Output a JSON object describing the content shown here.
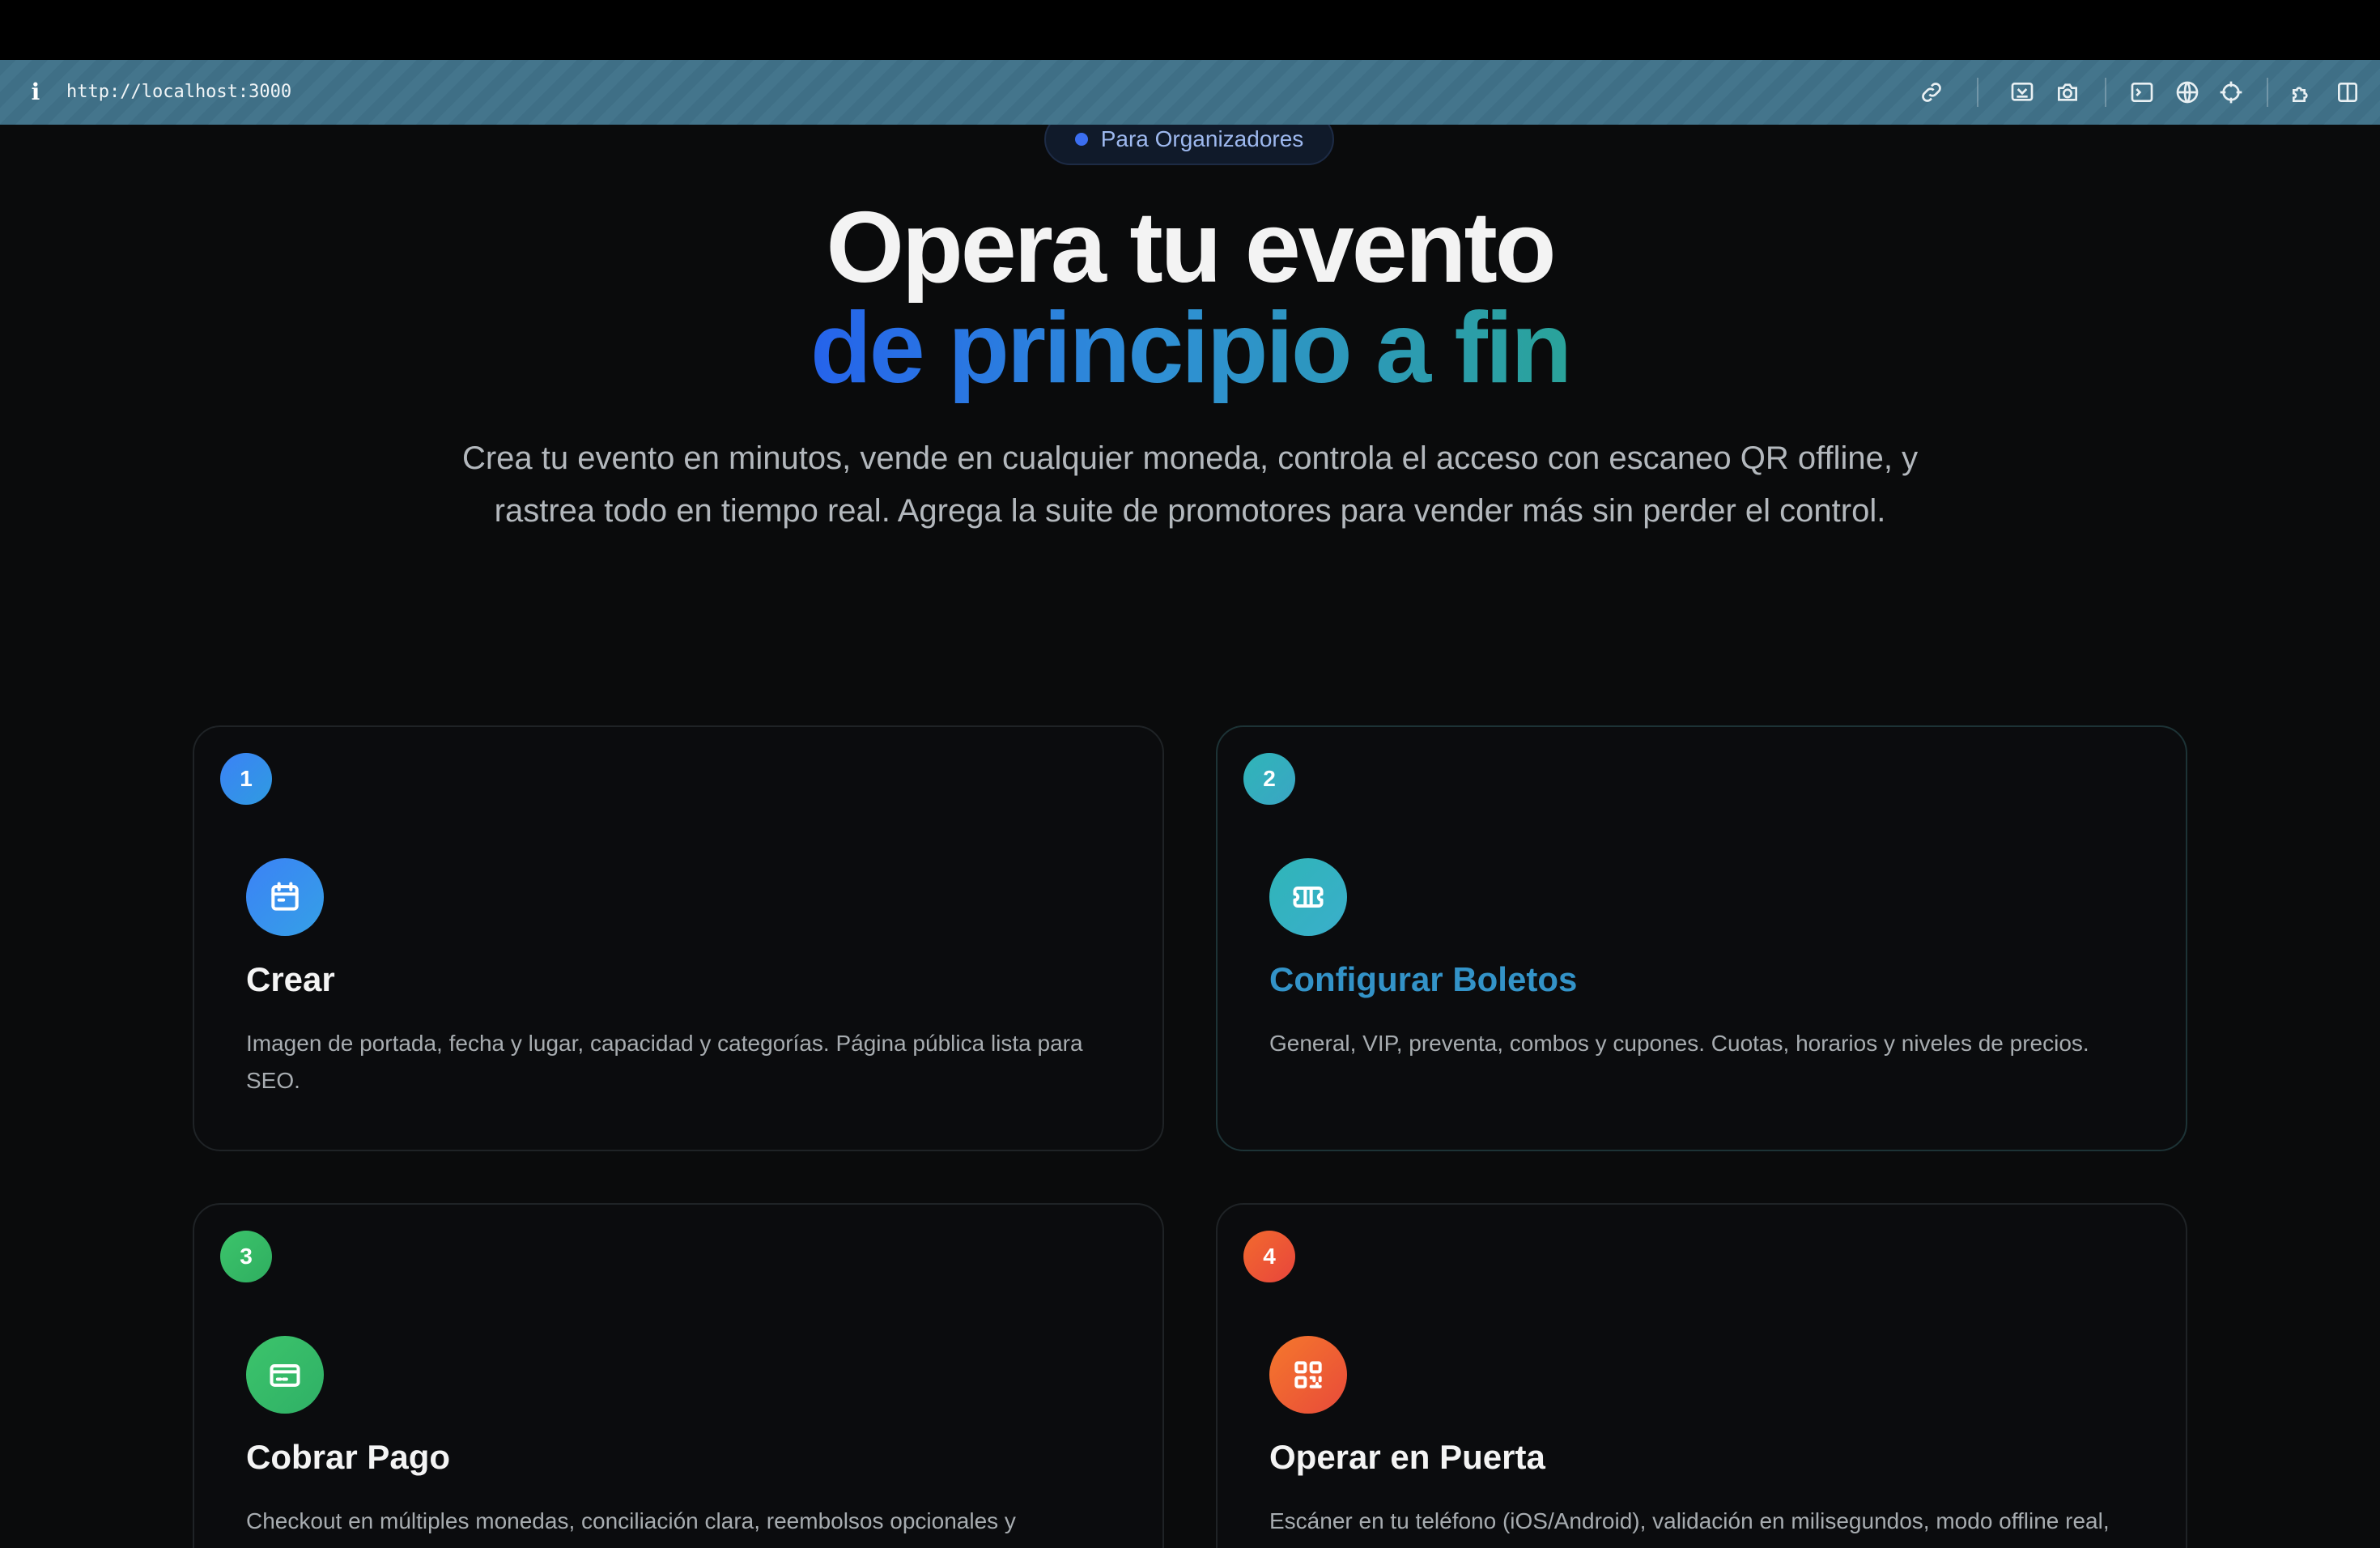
{
  "browser": {
    "url": "http://localhost:3000",
    "info_icon": "i",
    "toolbar_icons": [
      "link-icon",
      "inspect-icon",
      "camera-icon",
      "terminal-icon",
      "globe-icon",
      "crosshair-icon",
      "extensions-icon",
      "sidebar-icon"
    ]
  },
  "hero": {
    "pill_label": "Para Organizadores",
    "title_line1": "Opera tu evento",
    "title_line2": "de principio a fin",
    "subtitle": "Crea tu evento en minutos, vende en cualquier moneda, controla el acceso con escaneo QR offline, y rastrea todo en tiempo real. Agrega la suite de promotores para vender más sin perder el control."
  },
  "steps": [
    {
      "number": "1",
      "icon": "calendar-icon",
      "title": "Crear",
      "description": "Imagen de portada, fecha y lugar, capacidad y categorías. Página pública lista para SEO.",
      "color": "#3b82f6"
    },
    {
      "number": "2",
      "icon": "ticket-icon",
      "title": "Configurar Boletos",
      "description": "General, VIP, preventa, combos y cupones. Cuotas, horarios y niveles de precios.",
      "color": "#2fb5b8"
    },
    {
      "number": "3",
      "icon": "credit-card-icon",
      "title": "Cobrar Pago",
      "description": "Checkout en múltiples monedas, conciliación clara, reembolsos opcionales y",
      "color": "#3cc46b"
    },
    {
      "number": "4",
      "icon": "qr-code-icon",
      "title": "Operar en Puerta",
      "description": "Escáner en tu teléfono (iOS/Android), validación en milisegundos, modo offline real,",
      "color": "#f26a2e"
    }
  ],
  "colors": {
    "accent_blue": "#2563eb",
    "accent_teal": "#2aa39a",
    "title_highlight": "#3393c8"
  }
}
